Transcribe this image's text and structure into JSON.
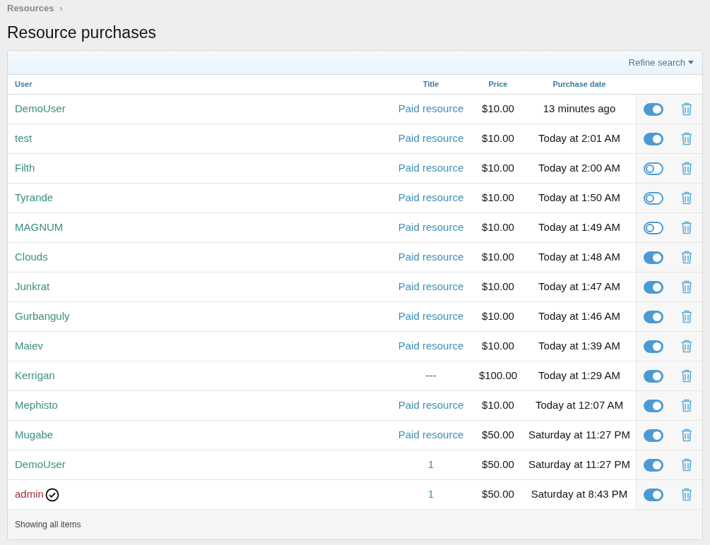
{
  "breadcrumb": [
    "Resources"
  ],
  "breadcrumb_separator": "›",
  "title": "Resource purchases",
  "refine": "Refine search",
  "columns": [
    "User",
    "Title",
    "Price",
    "Purchase date"
  ],
  "rows": [
    {
      "user": "DemoUser",
      "color": "#3b8f7f",
      "verified": false,
      "title": "Paid resource",
      "title_link": true,
      "price": "$10.00",
      "date": "13 minutes ago",
      "on": true
    },
    {
      "user": "test",
      "color": "#3b8f7f",
      "verified": false,
      "title": "Paid resource",
      "title_link": true,
      "price": "$10.00",
      "date": "Today at 2:01 AM",
      "on": true
    },
    {
      "user": "Filth",
      "color": "#3b8f7f",
      "verified": false,
      "title": "Paid resource",
      "title_link": true,
      "price": "$10.00",
      "date": "Today at 2:00 AM",
      "on": false
    },
    {
      "user": "Tyrande",
      "color": "#3b8f7f",
      "verified": false,
      "title": "Paid resource",
      "title_link": true,
      "price": "$10.00",
      "date": "Today at 1:50 AM",
      "on": false
    },
    {
      "user": "MAGNUM",
      "color": "#3b8f7f",
      "verified": false,
      "title": "Paid resource",
      "title_link": true,
      "price": "$10.00",
      "date": "Today at 1:49 AM",
      "on": false
    },
    {
      "user": "Clouds",
      "color": "#3b8f7f",
      "verified": false,
      "title": "Paid resource",
      "title_link": true,
      "price": "$10.00",
      "date": "Today at 1:48 AM",
      "on": true
    },
    {
      "user": "Junkrat",
      "color": "#3b8f7f",
      "verified": false,
      "title": "Paid resource",
      "title_link": true,
      "price": "$10.00",
      "date": "Today at 1:47 AM",
      "on": true
    },
    {
      "user": "Gurbanguly",
      "color": "#3b8f7f",
      "verified": false,
      "title": "Paid resource",
      "title_link": true,
      "price": "$10.00",
      "date": "Today at 1:46 AM",
      "on": true
    },
    {
      "user": "Maiev",
      "color": "#3b8f7f",
      "verified": false,
      "title": "Paid resource",
      "title_link": true,
      "price": "$10.00",
      "date": "Today at 1:39 AM",
      "on": true
    },
    {
      "user": "Kerrigan",
      "color": "#3b8f7f",
      "verified": false,
      "title": "---",
      "title_link": false,
      "price": "$100.00",
      "date": "Today at 1:29 AM",
      "on": true
    },
    {
      "user": "Mephisto",
      "color": "#3b8f7f",
      "verified": false,
      "title": "Paid resource",
      "title_link": true,
      "price": "$10.00",
      "date": "Today at 12:07 AM",
      "on": true
    },
    {
      "user": "Mugabe",
      "color": "#3b8f7f",
      "verified": false,
      "title": "Paid resource",
      "title_link": true,
      "price": "$50.00",
      "date": "Saturday at 11:27 PM",
      "on": true
    },
    {
      "user": "DemoUser",
      "color": "#3b8f7f",
      "verified": false,
      "title": "1",
      "title_link": true,
      "price": "$50.00",
      "date": "Saturday at 11:27 PM",
      "on": true
    },
    {
      "user": "admin",
      "color": "#a3303a",
      "verified": true,
      "title": "1",
      "title_link": true,
      "price": "$50.00",
      "date": "Saturday at 8:43 PM",
      "on": true
    }
  ],
  "footer": "Showing all items"
}
